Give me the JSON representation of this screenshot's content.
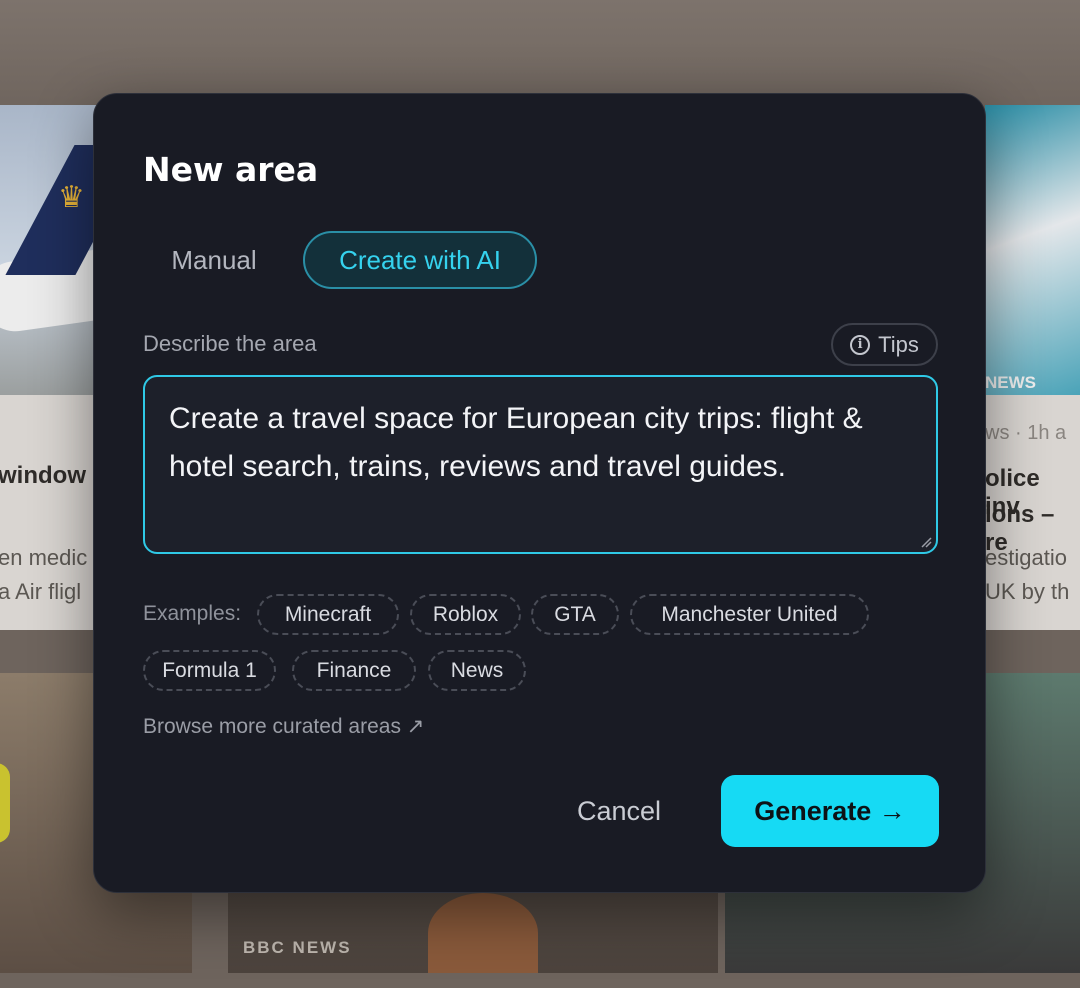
{
  "background": {
    "left_card": {
      "headline": "window r",
      "snippet_line1": "en medic",
      "snippet_line2": "a Air fligl"
    },
    "right_card": {
      "badge": "NEWS",
      "meta": "ws · 1h a",
      "headline_line1": "olice inv",
      "headline_line2": "ions – re",
      "snippet_line1": "estigatio",
      "snippet_line2": "UK by th"
    },
    "bottom_card": {
      "badge": "BBC NEWS"
    }
  },
  "modal": {
    "title": "New area",
    "tabs": {
      "manual": "Manual",
      "ai": "Create with AI"
    },
    "describe_label": "Describe the area",
    "tips_label": "Tips",
    "description": "Create a travel space for European city trips: flight & hotel search, trains, reviews and travel guides.",
    "examples_label": "Examples:",
    "examples": [
      "Minecraft",
      "Roblox",
      "GTA",
      "Manchester United",
      "Formula 1",
      "Finance",
      "News"
    ],
    "browse_label": "Browse more curated areas ↗",
    "cancel_label": "Cancel",
    "generate_label": "Generate →"
  },
  "colors": {
    "accent": "#16daf4",
    "modal_bg": "#191b24",
    "tab_active_text": "#35d2ee"
  }
}
